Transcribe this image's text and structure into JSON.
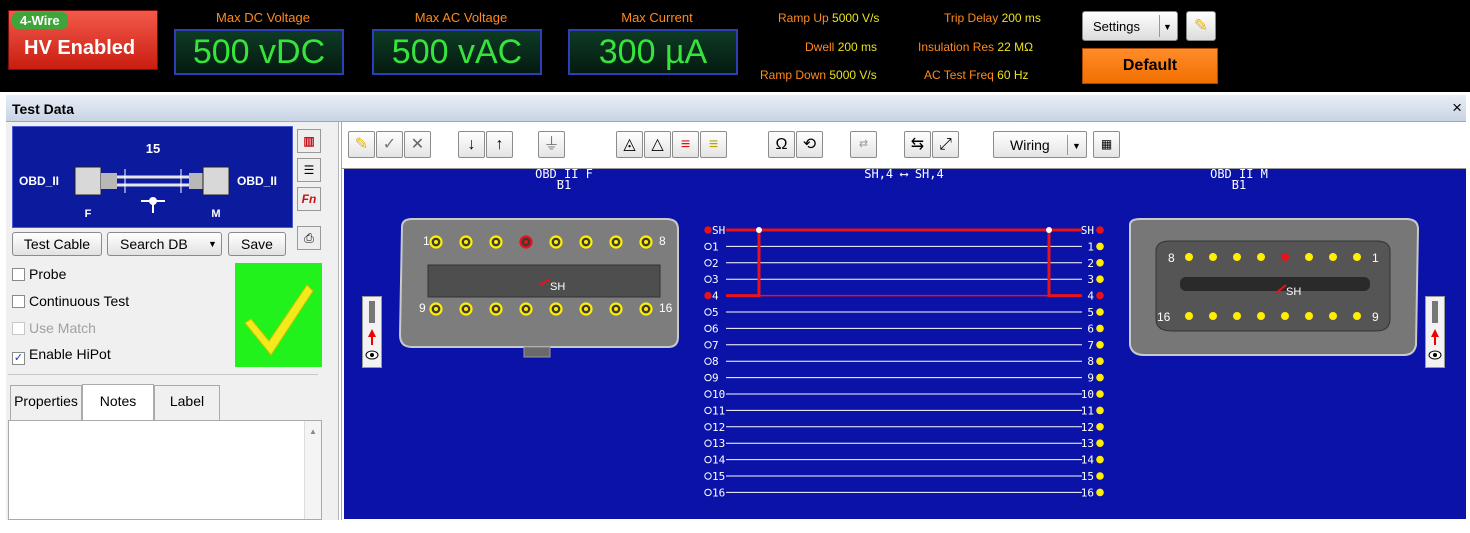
{
  "status": {
    "wire_mode": "4-Wire",
    "hv_label": "HV Enabled",
    "meters": [
      {
        "label": "Max DC Voltage",
        "value": "500 vDC"
      },
      {
        "label": "Max AC Voltage",
        "value": "500 vAC"
      },
      {
        "label": "Max Current",
        "value": "300 µA"
      }
    ],
    "params": {
      "ramp_up_label": "Ramp Up",
      "ramp_up": "5000 V/s",
      "dwell_label": "Dwell",
      "dwell": "200 ms",
      "ramp_down_label": "Ramp Down",
      "ramp_down": "5000 V/s",
      "trip_delay_label": "Trip Delay",
      "trip_delay": "200 ms",
      "insulation_label": "Insulation Res",
      "insulation": "22 MΩ",
      "ac_freq_label": "AC Test Freq",
      "ac_freq": "60 Hz"
    },
    "settings_label": "Settings",
    "profile_label": "Default"
  },
  "window": {
    "title": "Test Data",
    "close": "×"
  },
  "cable": {
    "count": "15",
    "left_name": "OBD_II",
    "right_name": "OBD_II",
    "left_gender": "F",
    "right_gender": "M"
  },
  "actions": {
    "test_cable": "Test Cable",
    "search_db": "Search DB",
    "save": "Save"
  },
  "options": [
    {
      "label": "Probe",
      "checked": false,
      "enabled": true
    },
    {
      "label": "Continuous Test",
      "checked": false,
      "enabled": true
    },
    {
      "label": "Use Match",
      "checked": false,
      "enabled": false
    },
    {
      "label": "Enable HiPot",
      "checked": true,
      "enabled": true
    }
  ],
  "pass_mark": "✓",
  "tabs": [
    "Properties",
    "Notes",
    "Label"
  ],
  "active_tab": "Notes",
  "toolbar": {
    "wiring_label": "Wiring"
  },
  "diagram": {
    "left_conn": {
      "name": "OBD_II F",
      "sub": "B1"
    },
    "right_conn": {
      "name": "OBD_II M",
      "sub": "B1"
    },
    "connection_note": "SH,4 ⟷ SH,4",
    "left_pin_labels": {
      "top_first": "1",
      "top_last": "8",
      "bottom_first": "9",
      "bottom_last": "16",
      "shield": "SH"
    },
    "right_pin_labels": {
      "top_first": "8",
      "top_last": "1",
      "bottom_first": "16",
      "bottom_last": "9",
      "shield": "SH"
    },
    "wires": [
      "SH",
      "1",
      "2",
      "3",
      "4",
      "5",
      "6",
      "7",
      "8",
      "9",
      "10",
      "11",
      "12",
      "13",
      "14",
      "15",
      "16"
    ],
    "highlighted_wires": [
      "SH",
      "4"
    ],
    "colors": {
      "background": "#0a12a8",
      "highlight": "#e8121a",
      "pin": "#ffee00",
      "wire": "#ffffff"
    }
  }
}
